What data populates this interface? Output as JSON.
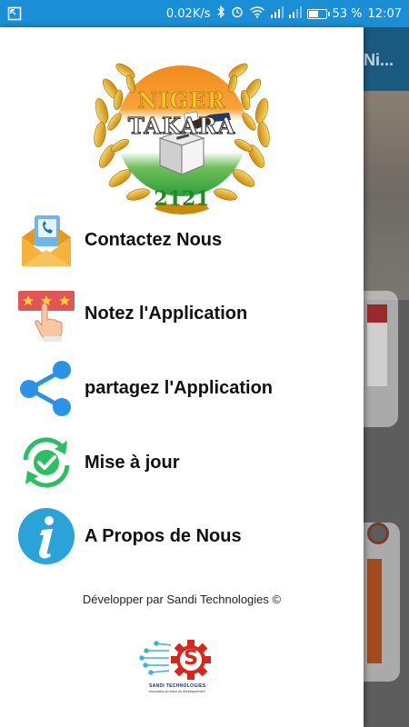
{
  "status_bar": {
    "speed": "0.02K/s",
    "battery_percent": "53 %",
    "battery_level": 0.53,
    "time": "12:07",
    "icons": [
      "screenshot-icon",
      "bluetooth-icon",
      "alarm-icon",
      "wifi-icon",
      "signal-icon",
      "signal-icon",
      "battery-icon"
    ]
  },
  "logo": {
    "line1": "NIGER",
    "line2": "TAKARA",
    "year": "2121",
    "icon": "ballot-box-icon"
  },
  "menu": [
    {
      "label": "Contactez Nous",
      "icon": "contact-mail-icon"
    },
    {
      "label": "Notez l'Application",
      "icon": "rate-stars-icon"
    },
    {
      "label": "partagez l'Application",
      "icon": "share-icon"
    },
    {
      "label": "Mise à jour",
      "icon": "update-icon"
    },
    {
      "label": "A Propos de Nous",
      "icon": "info-icon"
    }
  ],
  "footer": {
    "credit": "Développer par Sandi Technologies ©",
    "logo_letter": "S",
    "logo_name": "SANDI TECHNOLOGIES",
    "logo_tagline": "Innovation au cœur du développement"
  },
  "background_app": {
    "title_fragment": "Ni..."
  },
  "colors": {
    "status_bar": "#1a8fd6",
    "gold": "#e0a818",
    "niger_orange": "#f28a1a",
    "niger_green": "#2e9e3a",
    "share_blue": "#2a93e8",
    "update_green": "#2bbf63",
    "info_blue": "#2aa3d8"
  }
}
